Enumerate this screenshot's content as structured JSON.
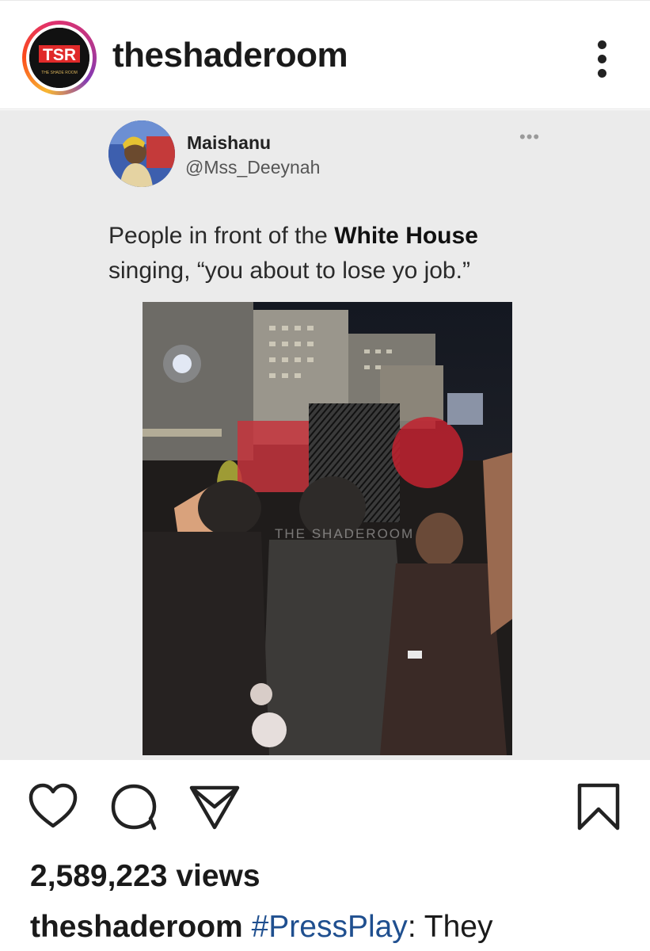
{
  "header": {
    "avatar_logo_text": "TSR",
    "avatar_logo_subtext": "THE SHADE ROOM",
    "username": "theshaderoom",
    "more_icon": "more-vertical-icon"
  },
  "tweet": {
    "display_name": "Maishanu",
    "handle": "@Mss_Deeynah",
    "options_icon": "more-horizontal-icon",
    "text_before": "People in front of the ",
    "text_bold": "White House",
    "text_after": " singing, “you about to lose yo job.”"
  },
  "video": {
    "watermark": "THE SHADEROOM"
  },
  "actions": {
    "like_icon": "heart-icon",
    "comment_icon": "comment-icon",
    "share_icon": "send-icon",
    "save_icon": "bookmark-icon"
  },
  "stats": {
    "views": "2,589,223 views"
  },
  "caption": {
    "username": "theshaderoom",
    "hashtag": "#PressPlay",
    "text": ": They"
  },
  "colors": {
    "hashtag": "#1f4f8f",
    "post_background": "#ebebeb"
  }
}
